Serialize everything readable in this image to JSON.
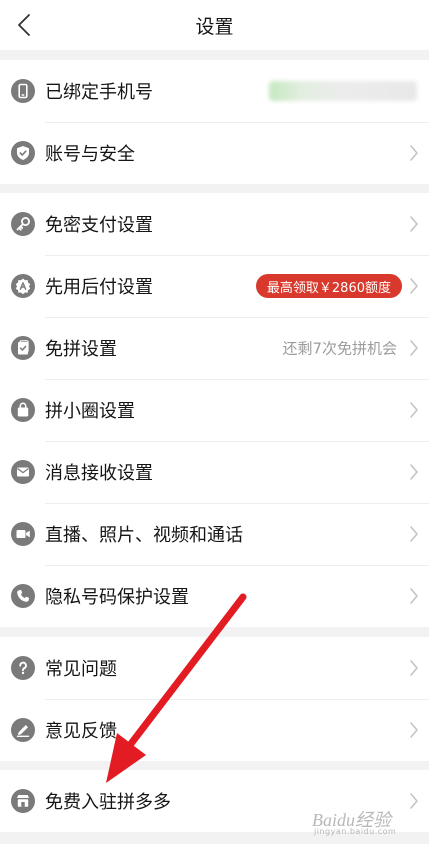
{
  "header": {
    "title": "设置",
    "back_icon": "chevron-left-icon"
  },
  "colors": {
    "icon_gray": "#7a7a7a",
    "badge_red": "#d8392c",
    "annotation_red": "#e31b23",
    "value_gray": "#9c9c9c"
  },
  "group1": [
    {
      "label": "已绑定手机号",
      "icon": "phone-icon"
    },
    {
      "label": "账号与安全",
      "icon": "shield-icon"
    }
  ],
  "group2": [
    {
      "label": "免密支付设置",
      "icon": "key-icon"
    },
    {
      "label": "先用后付设置",
      "icon": "pay-later-icon",
      "badge": "最高领取￥2860额度"
    },
    {
      "label": "免拼设置",
      "icon": "ticket-icon",
      "value": "还剩7次免拼机会"
    },
    {
      "label": "拼小圈设置",
      "icon": "bag-icon"
    },
    {
      "label": "消息接收设置",
      "icon": "message-icon"
    },
    {
      "label": "直播、照片、视频和通话",
      "icon": "video-icon"
    },
    {
      "label": "隐私号码保护设置",
      "icon": "phone-call-icon"
    }
  ],
  "group3": [
    {
      "label": "常见问题",
      "icon": "question-icon"
    },
    {
      "label": "意见反馈",
      "icon": "pencil-icon"
    }
  ],
  "group4": [
    {
      "label": "免费入驻拼多多",
      "icon": "store-icon"
    }
  ],
  "watermark": {
    "main": "Baidu经验",
    "sub": "jingyan.baidu.com"
  }
}
